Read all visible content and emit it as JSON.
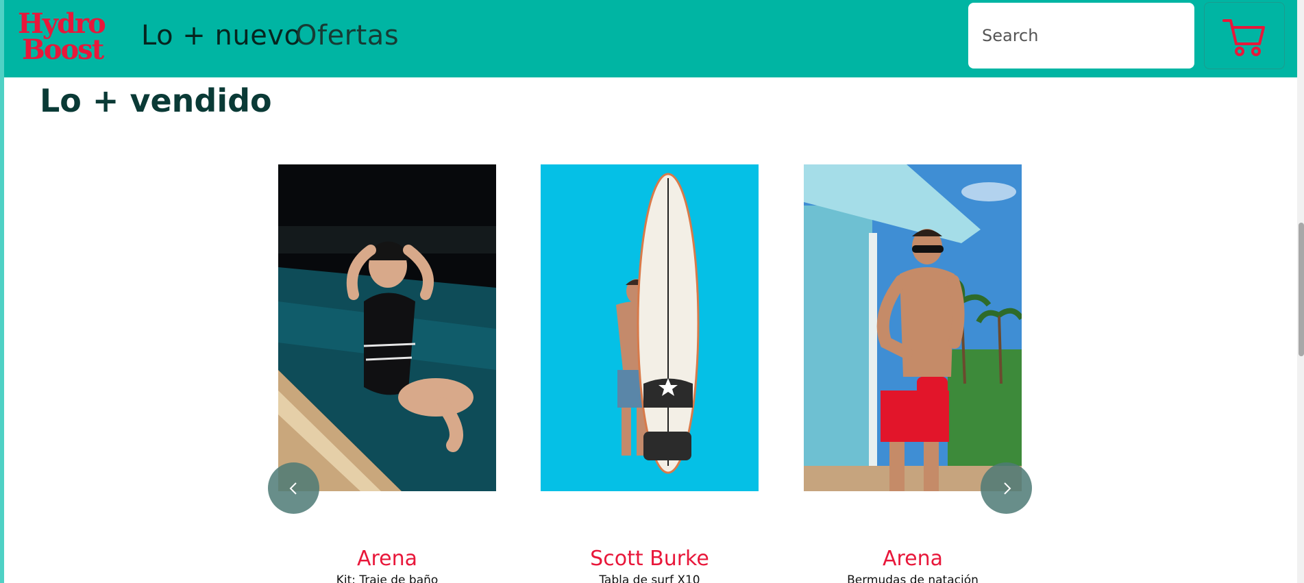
{
  "header": {
    "logo_text": "Hydro Boost",
    "nav": [
      {
        "label": "Lo + nuevo"
      },
      {
        "label": "Ofertas"
      }
    ],
    "search": {
      "placeholder": "Search",
      "value": ""
    },
    "cart_icon": "shopping-cart-icon"
  },
  "main": {
    "section_title": "Lo + vendido",
    "products": [
      {
        "brand": "Arena",
        "description": "Kit: Traje de baño",
        "image": "woman-swimmer-pool-photo"
      },
      {
        "brand": "Scott Burke",
        "description": "Tabla de surf X10",
        "image": "man-surfboard-photo"
      },
      {
        "brand": "Arena",
        "description": "Bermudas de natación",
        "image": "man-beach-hut-photo"
      }
    ],
    "carousel": {
      "prev_icon": "chevron-left-icon",
      "next_icon": "chevron-right-icon"
    }
  },
  "colors": {
    "navbar": "#00b5a3",
    "brand_red": "#e8173a",
    "title_dark": "#0a3a36",
    "carousel_button": "#4d7a76"
  }
}
